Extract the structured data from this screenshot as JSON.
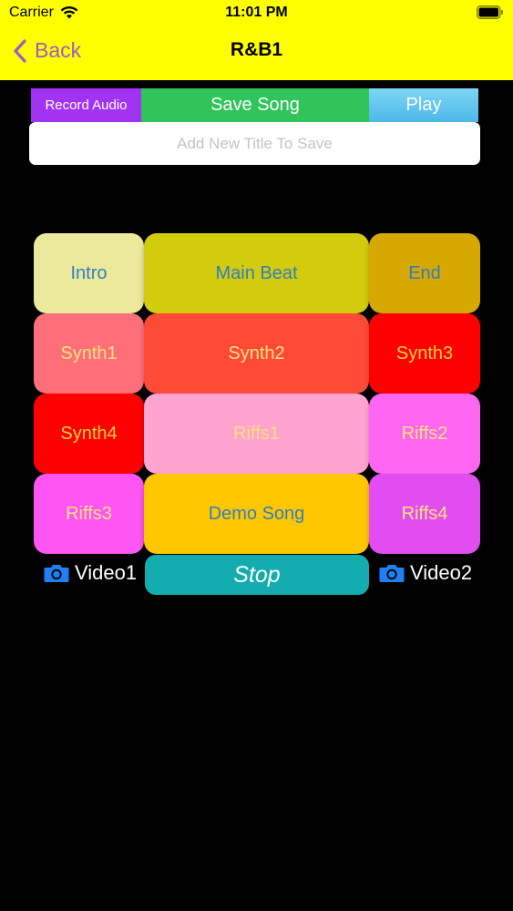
{
  "status": {
    "carrier": "Carrier",
    "time": "11:01 PM",
    "icons": [
      "wifi-icon",
      "battery-icon"
    ]
  },
  "nav": {
    "back_label": "Back",
    "title": "R&B1"
  },
  "toolbar": {
    "record_label": "Record Audio",
    "save_label": "Save Song",
    "play_label": "Play"
  },
  "title_input": {
    "value": "",
    "placeholder": "Add New Title To Save"
  },
  "pads": [
    {
      "label": "Intro",
      "bg": "#ece89c",
      "fg": "#2f7fc2"
    },
    {
      "label": "Main Beat",
      "bg": "#d3cb0d",
      "fg": "#2f7fc2"
    },
    {
      "label": "End",
      "bg": "#d6a800",
      "fg": "#2f7fc2"
    },
    {
      "label": "Synth1",
      "bg": "#ff6f79",
      "fg": "#ffe27a"
    },
    {
      "label": "Synth2",
      "bg": "#ff4a38",
      "fg": "#ffe27a"
    },
    {
      "label": "Synth3",
      "bg": "#ff0000",
      "fg": "#ffd23a"
    },
    {
      "label": "Synth4",
      "bg": "#ff0000",
      "fg": "#ffd23a"
    },
    {
      "label": "Riffs1",
      "bg": "#ffa3d1",
      "fg": "#ffe27a"
    },
    {
      "label": "Riffs2",
      "bg": "#ff66f2",
      "fg": "#ffe27a"
    },
    {
      "label": "Riffs3",
      "bg": "#ff55f4",
      "fg": "#ffe27a"
    },
    {
      "label": "Demo Song",
      "bg": "#ffc700",
      "fg": "#2f7fc2"
    },
    {
      "label": "Riffs4",
      "bg": "#e24df2",
      "fg": "#ffe27a"
    }
  ],
  "video": {
    "left_label": "Video1",
    "right_label": "Video2",
    "icon": "camera-icon",
    "icon_color": "#1f7ff5"
  },
  "stop_label": "Stop",
  "colors": {
    "header_bg": "#ffff00",
    "accent": "#a259c9",
    "background": "#000000"
  }
}
